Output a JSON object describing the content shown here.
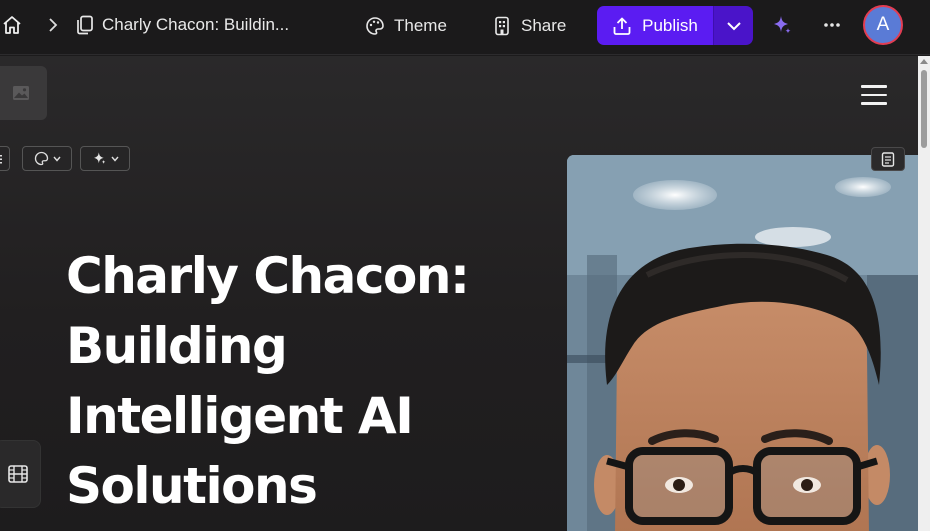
{
  "toolbar": {
    "doc_title": "Charly Chacon: Buildin...",
    "theme_label": "Theme",
    "share_label": "Share",
    "publish_label": "Publish",
    "avatar_initial": "A",
    "icons": [
      "home-icon",
      "chevron-right-icon",
      "document-icon",
      "palette-icon",
      "share-icon",
      "upload-icon",
      "chevron-down-icon",
      "sparkle-icon",
      "more-icon"
    ]
  },
  "canvas": {
    "hero_title": "Charly Chacon: Building Intelligent AI Solutions",
    "icons": [
      "image-placeholder-icon",
      "menu-icon",
      "list-icon",
      "palette-icon",
      "sparkle-icon",
      "notes-icon",
      "film-icon"
    ]
  },
  "colors": {
    "publish": "#5b1cf2",
    "publish_dropdown": "#4a14c9",
    "avatar_bg": "#5a7bd6",
    "avatar_ring": "#e33d52",
    "ai_sparkle": "#8a6cf0",
    "background": "#1c1b1c"
  }
}
